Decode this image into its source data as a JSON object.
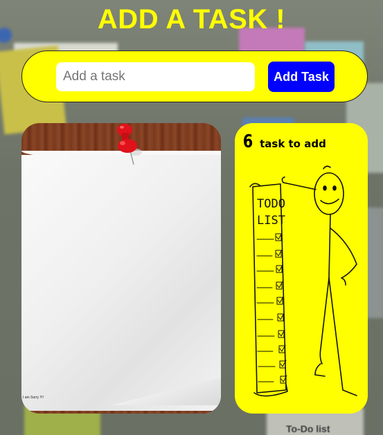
{
  "page": {
    "title": "ADD A TASK !"
  },
  "form": {
    "input_placeholder": "Add a task",
    "input_value": "",
    "add_button_label": "Add Task"
  },
  "paper_panel": {
    "note_text": "I am Sorry !!!!"
  },
  "todo_panel": {
    "count": "6",
    "count_label": "task to add",
    "illustration_heading_line1": "TODO",
    "illustration_heading_line2": "LIST"
  },
  "background": {
    "caption": "To-Do list"
  },
  "colors": {
    "accent_yellow": "#ffff00",
    "button_blue": "#0000ff",
    "pin_red": "#e0121b"
  }
}
